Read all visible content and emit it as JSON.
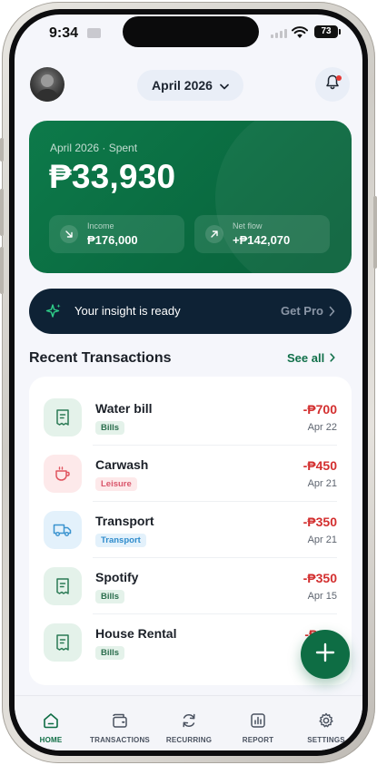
{
  "status_bar": {
    "time": "9:34",
    "battery": "73"
  },
  "header": {
    "month": "April 2026",
    "avatar": "user-avatar",
    "notification_icon": "bell-icon"
  },
  "summary": {
    "label": "April 2026 · Spent",
    "spent": "₱33,930",
    "income_label": "Income",
    "income_value": "₱176,000",
    "netflow_label": "Net flow",
    "netflow_value": "+₱142,070"
  },
  "insight": {
    "text": "Your insight is ready",
    "cta": "Get Pro"
  },
  "transactions": {
    "title": "Recent Transactions",
    "see_all": "See all",
    "items": [
      {
        "name": "Water bill",
        "category": "Bills",
        "amount": "-₱700",
        "date": "Apr 22",
        "icon": "receipt-icon"
      },
      {
        "name": "Carwash",
        "category": "Leisure",
        "amount": "-₱450",
        "date": "Apr 21",
        "icon": "cup-icon"
      },
      {
        "name": "Transport",
        "category": "Transport",
        "amount": "-₱350",
        "date": "Apr 21",
        "icon": "truck-icon"
      },
      {
        "name": "Spotify",
        "category": "Bills",
        "amount": "-₱350",
        "date": "Apr 15",
        "icon": "receipt-icon"
      },
      {
        "name": "House Rental",
        "category": "Bills",
        "amount": "-₱9,",
        "date": "",
        "icon": "receipt-icon"
      }
    ]
  },
  "nav": {
    "items": [
      {
        "label": "HOME",
        "icon": "home-icon",
        "active": true
      },
      {
        "label": "TRANSACTIONS",
        "icon": "wallet-icon",
        "active": false
      },
      {
        "label": "RECURRING",
        "icon": "refresh-icon",
        "active": false
      },
      {
        "label": "REPORT",
        "icon": "report-icon",
        "active": false
      },
      {
        "label": "SETTINGS",
        "icon": "gear-icon",
        "active": false
      }
    ]
  },
  "colors": {
    "brand_green": "#0e6d44",
    "expense_red": "#d32f2f",
    "bills_tag_bg": "#e4f2ea",
    "leisure_tag_bg": "#fde9ea",
    "transport_tag_bg": "#e3f1fb"
  }
}
